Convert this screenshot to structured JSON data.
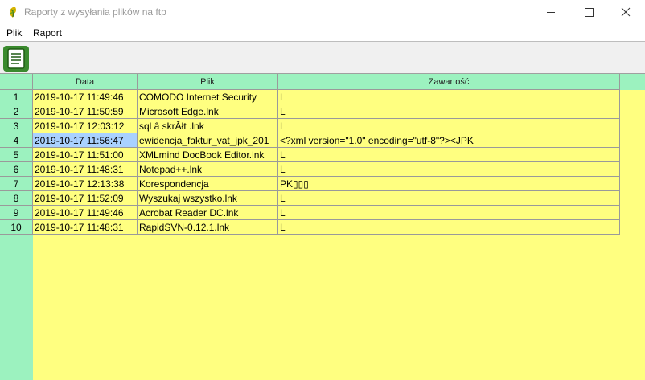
{
  "window": {
    "title": "Raporty z wysyłania plików na ftp",
    "icon": "app-leaf-icon"
  },
  "menu": [
    {
      "label": "Plik"
    },
    {
      "label": "Raport"
    }
  ],
  "toolbar": {
    "report_button_icon": "document-list-icon"
  },
  "grid": {
    "columns": [
      "Data",
      "Plik",
      "Zawartość"
    ],
    "selected_row": 4,
    "rows": [
      {
        "n": "1",
        "data": "2019-10-17 11:49:46",
        "plik": "COMODO Internet Security",
        "zawartosc": "L"
      },
      {
        "n": "2",
        "data": "2019-10-17 11:50:59",
        "plik": "Microsoft Edge.lnk",
        "zawartosc": "L"
      },
      {
        "n": "3",
        "data": "2019-10-17 12:03:12",
        "plik": "sql â skrĂłt .lnk",
        "zawartosc": "L"
      },
      {
        "n": "4",
        "data": "2019-10-17 11:56:47",
        "plik": "ewidencja_faktur_vat_jpk_201",
        "zawartosc": "<?xml version=\"1.0\" encoding=\"utf-8\"?><JPK"
      },
      {
        "n": "5",
        "data": "2019-10-17 11:51:00",
        "plik": "XMLmind DocBook Editor.lnk",
        "zawartosc": "L"
      },
      {
        "n": "6",
        "data": "2019-10-17 11:48:31",
        "plik": "Notepad++.lnk",
        "zawartosc": "L"
      },
      {
        "n": "7",
        "data": "2019-10-17 12:13:38",
        "plik": "Korespondencja",
        "zawartosc": "PK▯▯▯"
      },
      {
        "n": "8",
        "data": "2019-10-17 11:52:09",
        "plik": "Wyszukaj wszystko.lnk",
        "zawartosc": "L"
      },
      {
        "n": "9",
        "data": "2019-10-17 11:49:46",
        "plik": "Acrobat Reader DC.lnk",
        "zawartosc": "L"
      },
      {
        "n": "10",
        "data": "2019-10-17 11:48:31",
        "plik": "RapidSVN-0.12.1.lnk",
        "zawartosc": "L"
      }
    ]
  },
  "colors": {
    "header_bg": "#9cf2bf",
    "grid_bg": "#ffff80",
    "selection": "#a9d1ff",
    "toolbar_button": "#3a8a2e"
  }
}
